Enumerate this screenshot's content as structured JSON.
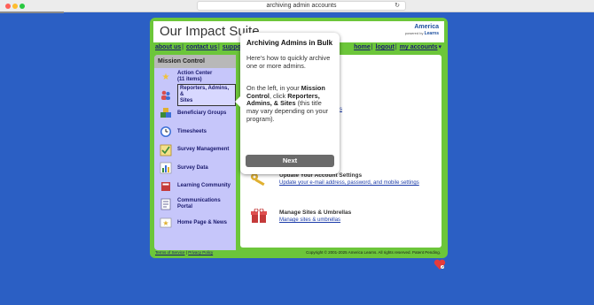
{
  "browser": {
    "url": "archiving admin accounts",
    "reload_icon": "reload-icon"
  },
  "app": {
    "title": "Our Impact Suite",
    "logo": {
      "name_top": "America",
      "name_bottom": "Learns",
      "powered_by": "powered by"
    }
  },
  "links_left": [
    "about us",
    "contact us",
    "support"
  ],
  "links_right": [
    "home",
    "logout",
    "my accounts"
  ],
  "sidebar": {
    "header": "Mission Control",
    "items": [
      {
        "label": "Action Center",
        "sublabel": "(11 items)",
        "icon": "star-icon",
        "color": "#f0c23a"
      },
      {
        "label": "Reporters, Admins, &",
        "sublabel": "Sites",
        "icon": "people-icon",
        "color": "#d94e4e"
      },
      {
        "label": "Beneficiary Groups",
        "sublabel": "",
        "icon": "blocks-icon",
        "color": "#3a8a3a"
      },
      {
        "label": "Timesheets",
        "sublabel": "",
        "icon": "clock-icon",
        "color": "#3b6fd6"
      },
      {
        "label": "Survey Management",
        "sublabel": "",
        "icon": "checklist-icon",
        "color": "#e0b030"
      },
      {
        "label": "Survey Data",
        "sublabel": "",
        "icon": "bar-chart-icon",
        "color": "#3a8a3a"
      },
      {
        "label": "Learning Community",
        "sublabel": "",
        "icon": "book-icon",
        "color": "#c43a3a"
      },
      {
        "label": "Communications",
        "sublabel": "Portal",
        "icon": "document-icon",
        "color": "#6a6a9a"
      },
      {
        "label": "Home Page & News",
        "sublabel": "",
        "icon": "news-icon",
        "color": "#e0b030"
      }
    ]
  },
  "content": {
    "fragment_link": "ations",
    "items": [
      {
        "title": "Update Your Account Settings",
        "link": "Update your e-mail address, password, and mobile settings",
        "icon": "key-icon",
        "color": "#e0b030"
      },
      {
        "title": "Manage Sites & Umbrellas",
        "link": "Manage sites & umbrellas",
        "icon": "gift-icon",
        "color": "#c43a3a"
      }
    ]
  },
  "footer": {
    "terms": "Terms of Service",
    "privacy": "Privacy Policy",
    "copyright": "Copyright © 2001-2025 America Learns. All rights reserved. Patent Pending."
  },
  "popover": {
    "title": "Archiving Admins in Bulk",
    "body1": "Here's how to quickly archive one or more admins.",
    "body2_pre": "On the left, in your ",
    "body2_b1": "Mission Control",
    "body2_mid": ", click ",
    "body2_b2": "Reporters, Admins, & Sites",
    "body2_post": " (this title may vary depending on your program).",
    "button": "Next"
  },
  "widget_icon": "heart-icon"
}
